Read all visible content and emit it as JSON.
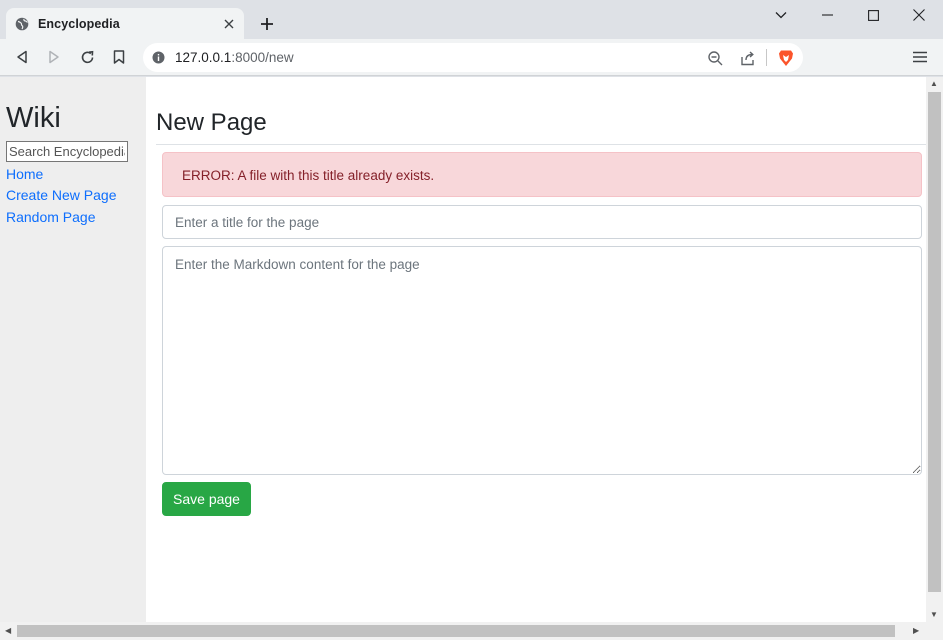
{
  "browser": {
    "tab_title": "Encyclopedia",
    "url_host": "127.0.0.1",
    "url_path": ":8000/new",
    "colors": {
      "brave_accent": "#fb542b",
      "chrome_bg": "#dee1e6",
      "toolbar_bg": "#f1f3f4"
    }
  },
  "sidebar": {
    "title": "Wiki",
    "search_placeholder": "Search Encyclopedia",
    "links": [
      "Home",
      "Create New Page",
      "Random Page"
    ]
  },
  "main": {
    "page_title": "New Page",
    "error_message": "ERROR: A file with this title already exists.",
    "title_placeholder": "Enter a title for the page",
    "content_placeholder": "Enter the Markdown content for the page",
    "save_label": "Save page"
  },
  "colors": {
    "link": "#0d6efd",
    "alert_bg": "#f8d7da",
    "alert_text": "#842029",
    "save_button": "#28a745"
  }
}
